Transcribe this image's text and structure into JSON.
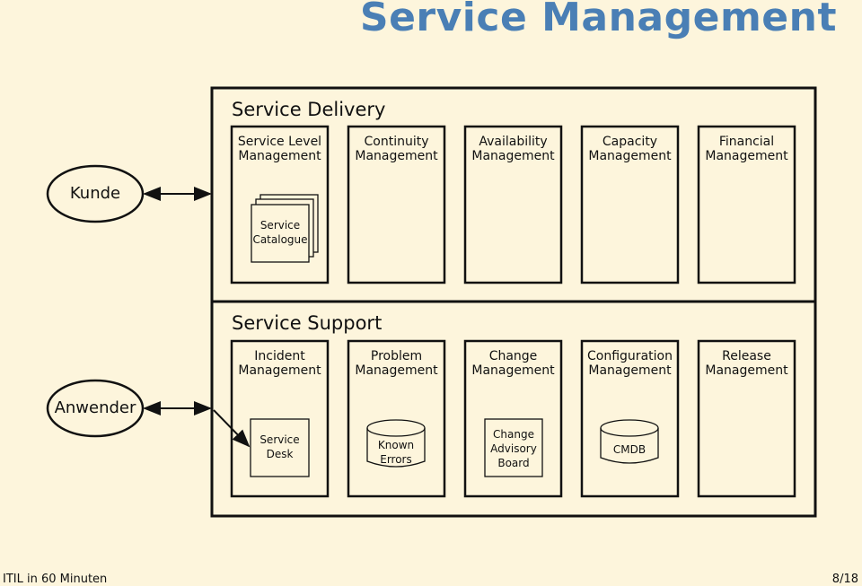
{
  "title": "Service Management",
  "actors": [
    {
      "label": "Kunde"
    },
    {
      "label": "Anwender"
    }
  ],
  "delivery": {
    "heading": "Service Delivery",
    "processes": [
      {
        "line1": "Service Level",
        "line2": "Management"
      },
      {
        "line1": "Continuity",
        "line2": "Management"
      },
      {
        "line1": "Availability",
        "line2": "Management"
      },
      {
        "line1": "Capacity",
        "line2": "Management"
      },
      {
        "line1": "Financial",
        "line2": "Management"
      }
    ],
    "artifact": {
      "line1": "Service",
      "line2": "Catalogue"
    }
  },
  "support": {
    "heading": "Service Support",
    "processes": [
      {
        "line1": "Incident",
        "line2": "Management"
      },
      {
        "line1": "Problem",
        "line2": "Management"
      },
      {
        "line1": "Change",
        "line2": "Management"
      },
      {
        "line1": "Configuration",
        "line2": "Management"
      },
      {
        "line1": "Release",
        "line2": "Management"
      }
    ],
    "artifacts": [
      {
        "line1": "Service",
        "line2": "Desk"
      },
      {
        "line1": "Known",
        "line2": "Errors"
      },
      {
        "line1": "Change",
        "line2": "Advisory",
        "line3": "Board"
      },
      {
        "line1": "CMDB"
      }
    ]
  },
  "footer": {
    "left": "ITIL in 60 Minuten",
    "right": "8/18"
  }
}
